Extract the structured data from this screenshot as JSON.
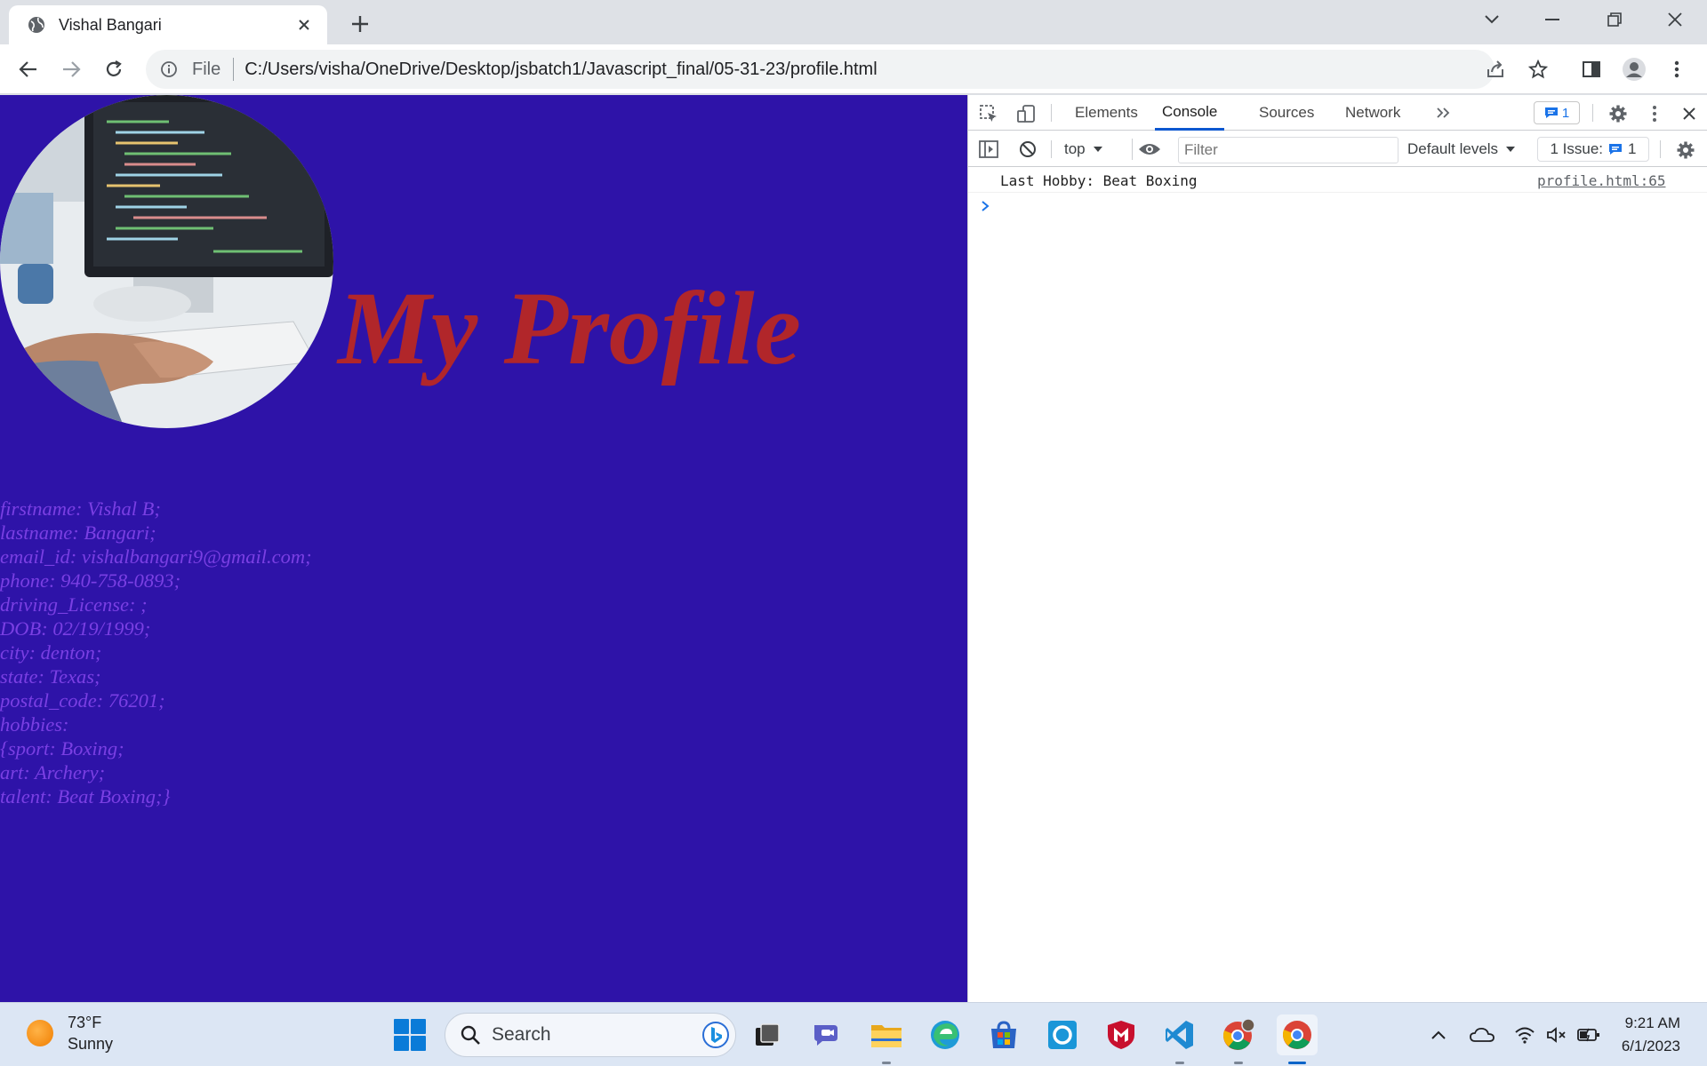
{
  "browser": {
    "tab_title": "Vishal Bangari",
    "url_scheme": "File",
    "url": "C:/Users/visha/OneDrive/Desktop/jsbatch1/Javascript_final/05-31-23/profile.html"
  },
  "page": {
    "heading": "My Profile",
    "background_color": "#2e13a8",
    "heading_color": "#b1262a",
    "text_color": "#7a3fe3",
    "profile_lines": [
      "firstname: Vishal B;",
      "lastname: Bangari;",
      "email_id: vishalbangari9@gmail.com;",
      "phone: 940-758-0893;",
      "driving_License: ;",
      "DOB: 02/19/1999;",
      "city: denton;",
      "state: Texas;",
      "postal_code: 76201;",
      "hobbies:",
      "{sport: Boxing;",
      "art: Archery;",
      "talent: Beat Boxing;}"
    ]
  },
  "devtools": {
    "tabs": [
      "Elements",
      "Console",
      "Sources",
      "Network"
    ],
    "active_tab": "Console",
    "message_badge": "1",
    "context": "top",
    "filter_placeholder": "Filter",
    "levels": "Default levels",
    "issues_label": "1 Issue:",
    "issues_count": "1",
    "console_messages": [
      {
        "text": "Last Hobby: Beat Boxing",
        "source": "profile.html:65"
      }
    ]
  },
  "taskbar": {
    "temperature": "73°F",
    "condition": "Sunny",
    "search_label": "Search",
    "time": "9:21 AM",
    "date": "6/1/2023"
  }
}
